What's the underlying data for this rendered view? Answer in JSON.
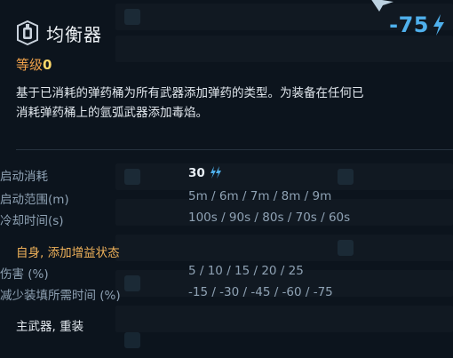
{
  "perk": {
    "title": "均衡器",
    "cost": "-75",
    "level_label": "等级",
    "level_value": "0",
    "description_line1": "基于已消耗的弹药桶为所有武器添加弹药的类型。为装备在任何已",
    "description_line2": "消耗弹药桶上的氩弧武器添加毒焰。"
  },
  "activation": {
    "cost_label": "启动消耗",
    "cost_value": "30",
    "range_label": "启动范围(m)",
    "range_values": "5m / 6m / 7m / 8m / 9m",
    "cooldown_label": "冷却时间(s)",
    "cooldown_values": "100s / 90s / 80s / 70s / 60s"
  },
  "buff": {
    "section_label": "自身, 添加增益状态",
    "damage_label": "伤害 (%)",
    "damage_values": "5 / 10 / 15 / 20 / 25",
    "reload_label": "减少装填所需时间 (%)",
    "reload_values": "-15 / -30 / -45 / -60 / -75"
  },
  "weapon_types": "主武器, 重装",
  "colors": {
    "accent": "#4fb0ec",
    "level_label": "#f0a24a",
    "section": "#f0b25a",
    "background": "#0c141d"
  },
  "icons": {
    "perk": "equalizer-perk-icon",
    "cost": "lightning-bolt-icon",
    "energy": "double-bolt-icon"
  }
}
